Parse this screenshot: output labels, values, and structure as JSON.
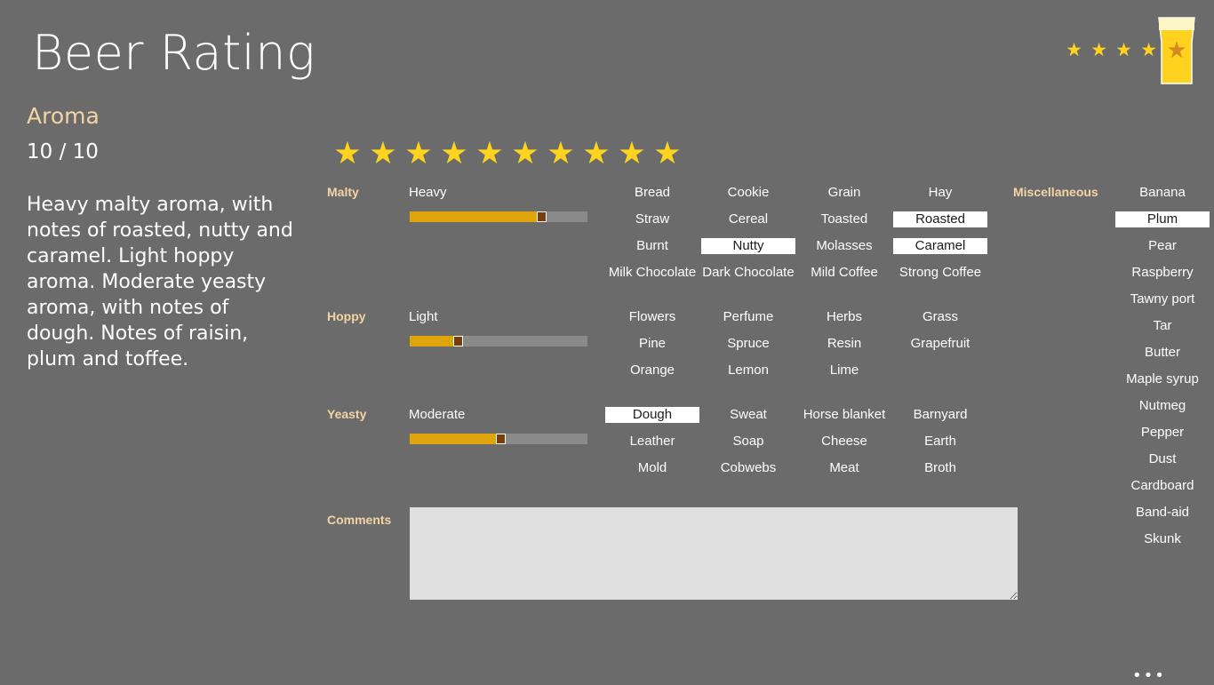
{
  "app": {
    "title": "Beer Rating"
  },
  "section": {
    "title": "Aroma",
    "score": "10 / 10"
  },
  "summary": "Heavy malty aroma, with notes of roasted, nutty and caramel. Light hoppy aroma. Moderate yeasty aroma, with notes of dough. Notes of raisin, plum and toffee.",
  "header_rating": {
    "stars_shown": 5,
    "star_glyph": "★"
  },
  "rating": {
    "value": 10,
    "max": 10,
    "star_glyph": "★"
  },
  "colors": {
    "background": "#6b6b6b",
    "accent": "#e0a50c",
    "star": "#ffd21f",
    "label": "#f3d4a4"
  },
  "categories": [
    {
      "label": "Malty",
      "level": "Heavy",
      "level_fraction": 0.74,
      "tags": [
        {
          "label": "Bread",
          "selected": false
        },
        {
          "label": "Cookie",
          "selected": false
        },
        {
          "label": "Grain",
          "selected": false
        },
        {
          "label": "Hay",
          "selected": false
        },
        {
          "label": "Straw",
          "selected": false
        },
        {
          "label": "Cereal",
          "selected": false
        },
        {
          "label": "Toasted",
          "selected": false
        },
        {
          "label": "Roasted",
          "selected": true
        },
        {
          "label": "Burnt",
          "selected": false
        },
        {
          "label": "Nutty",
          "selected": true
        },
        {
          "label": "Molasses",
          "selected": false
        },
        {
          "label": "Caramel",
          "selected": true
        },
        {
          "label": "Milk Chocolate",
          "selected": false
        },
        {
          "label": "Dark Chocolate",
          "selected": false
        },
        {
          "label": "Mild Coffee",
          "selected": false
        },
        {
          "label": "Strong Coffee",
          "selected": false
        }
      ]
    },
    {
      "label": "Hoppy",
      "level": "Light",
      "level_fraction": 0.27,
      "tags": [
        {
          "label": "Flowers",
          "selected": false
        },
        {
          "label": "Perfume",
          "selected": false
        },
        {
          "label": "Herbs",
          "selected": false
        },
        {
          "label": "Grass",
          "selected": false
        },
        {
          "label": "Pine",
          "selected": false
        },
        {
          "label": "Spruce",
          "selected": false
        },
        {
          "label": "Resin",
          "selected": false
        },
        {
          "label": "Grapefruit",
          "selected": false
        },
        {
          "label": "Orange",
          "selected": false
        },
        {
          "label": "Lemon",
          "selected": false
        },
        {
          "label": "Lime",
          "selected": false
        }
      ]
    },
    {
      "label": "Yeasty",
      "level": "Moderate",
      "level_fraction": 0.51,
      "tags": [
        {
          "label": "Dough",
          "selected": true
        },
        {
          "label": "Sweat",
          "selected": false
        },
        {
          "label": "Horse blanket",
          "selected": false
        },
        {
          "label": "Barnyard",
          "selected": false
        },
        {
          "label": "Leather",
          "selected": false
        },
        {
          "label": "Soap",
          "selected": false
        },
        {
          "label": "Cheese",
          "selected": false
        },
        {
          "label": "Earth",
          "selected": false
        },
        {
          "label": "Mold",
          "selected": false
        },
        {
          "label": "Cobwebs",
          "selected": false
        },
        {
          "label": "Meat",
          "selected": false
        },
        {
          "label": "Broth",
          "selected": false
        }
      ]
    }
  ],
  "miscellaneous": {
    "label": "Miscellaneous",
    "tags": [
      {
        "label": "Banana",
        "selected": false
      },
      {
        "label": "Plum",
        "selected": true
      },
      {
        "label": "Pear",
        "selected": false
      },
      {
        "label": "Raspberry",
        "selected": false
      },
      {
        "label": "Tawny port",
        "selected": false
      },
      {
        "label": "Tar",
        "selected": false
      },
      {
        "label": "Butter",
        "selected": false
      },
      {
        "label": "Maple syrup",
        "selected": false
      },
      {
        "label": "Nutmeg",
        "selected": false
      },
      {
        "label": "Pepper",
        "selected": false
      },
      {
        "label": "Dust",
        "selected": false
      },
      {
        "label": "Cardboard",
        "selected": false
      },
      {
        "label": "Band-aid",
        "selected": false
      },
      {
        "label": "Skunk",
        "selected": false
      }
    ]
  },
  "comments": {
    "label": "Comments",
    "value": ""
  },
  "more_button": {
    "label": "•••"
  }
}
